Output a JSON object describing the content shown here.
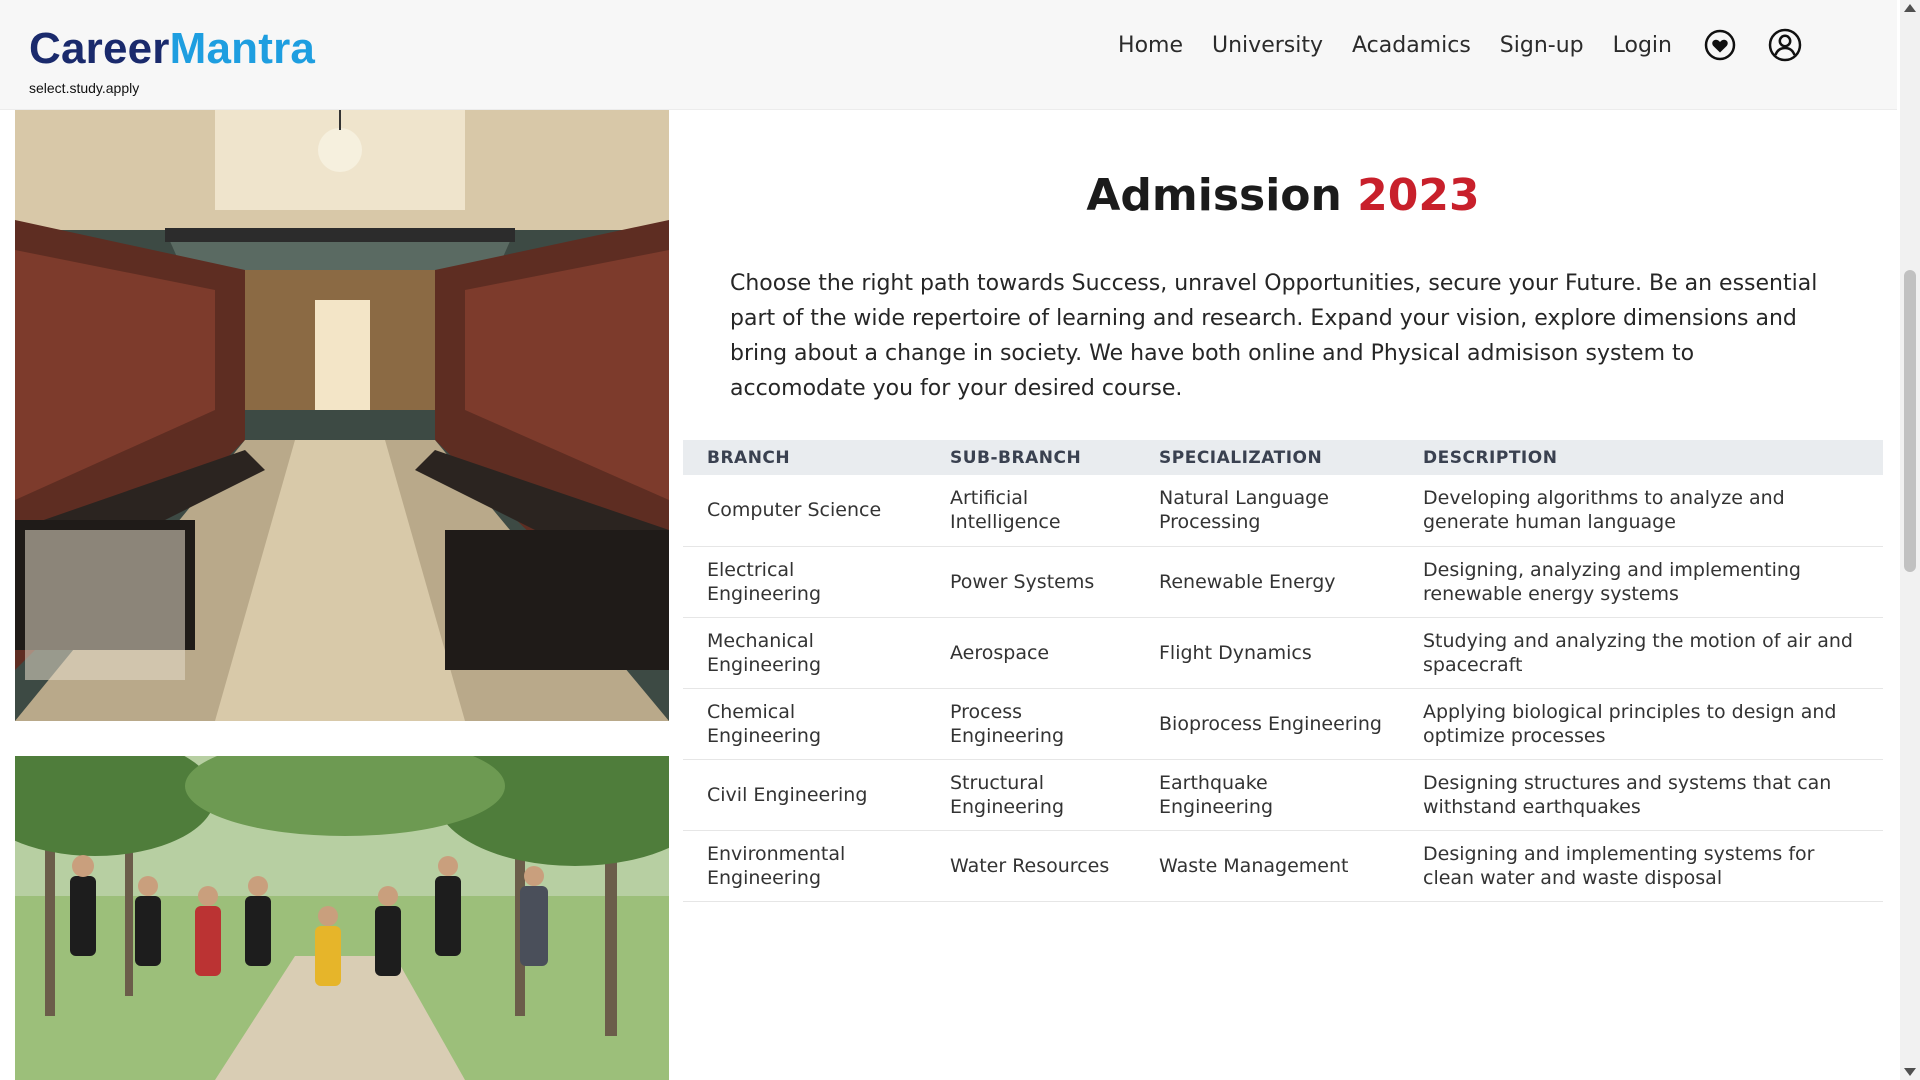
{
  "brand": {
    "part1": "Career",
    "part2": "Mantra",
    "tagline": "select.study.apply"
  },
  "nav": {
    "links": [
      "Home",
      "University",
      "Acadamics",
      "Sign-up",
      "Login"
    ],
    "icons": [
      "heart-icon",
      "user-account-icon"
    ]
  },
  "admission": {
    "title": "Admission",
    "year": "2023",
    "intro": "Choose the right path towards Success, unravel Opportunities, secure your Future. Be an essential part of the wide repertoire of learning and research. Expand your vision, explore dimensions and bring about a change in society. We have both online and Physical admisison system to accomodate you for your desired course."
  },
  "table": {
    "headers": [
      "BRANCH",
      "SUB-BRANCH",
      "SPECIALIZATION",
      "DESCRIPTION"
    ],
    "rows": [
      [
        "Computer Science",
        "Artificial Intelligence",
        "Natural Language Processing",
        "Developing algorithms to analyze and generate human language"
      ],
      [
        "Electrical Engineering",
        "Power Systems",
        "Renewable Energy",
        "Designing, analyzing and implementing renewable energy systems"
      ],
      [
        "Mechanical Engineering",
        "Aerospace",
        "Flight Dynamics",
        "Studying and analyzing the motion of air and spacecraft"
      ],
      [
        "Chemical Engineering",
        "Process Engineering",
        "Bioprocess Engineering",
        "Applying biological principles to design and optimize processes"
      ],
      [
        "Civil Engineering",
        "Structural Engineering",
        "Earthquake Engineering",
        "Designing structures and systems that can withstand earthquakes"
      ],
      [
        "Environmental Engineering",
        "Water Resources",
        "Waste Management",
        "Designing and implementing systems for clean water and waste disposal"
      ]
    ]
  },
  "colors": {
    "brand_dark": "#1a2a6c",
    "brand_light": "#1e9ee0",
    "year_red": "#c8202b",
    "table_header_bg": "#e9ecef"
  }
}
